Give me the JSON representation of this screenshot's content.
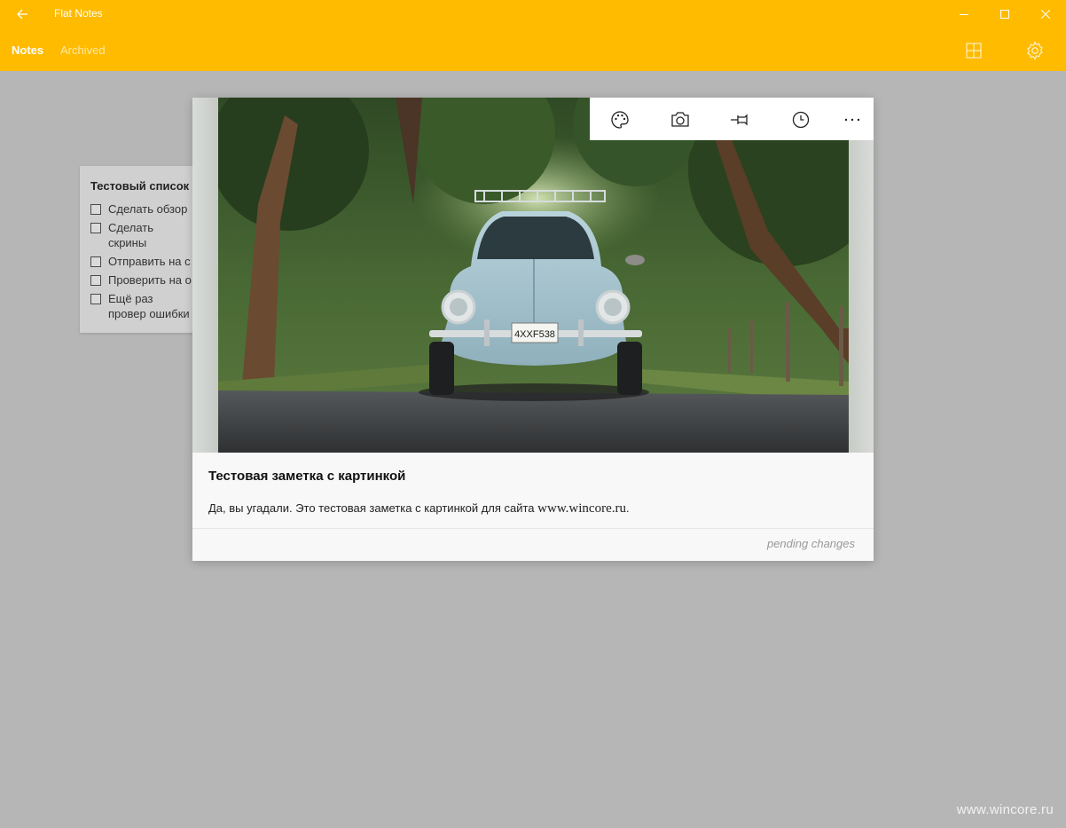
{
  "window": {
    "title": "Flat Notes",
    "back_icon": "arrow-left-icon",
    "minimize_icon": "minimize-icon",
    "maximize_icon": "maximize-icon",
    "close_icon": "close-icon"
  },
  "nav": {
    "tabs": [
      {
        "label": "Notes",
        "active": true
      },
      {
        "label": "Archived",
        "active": false
      }
    ],
    "layout_icon": "grid-layout-icon",
    "settings_icon": "gear-icon"
  },
  "background_note": {
    "title": "Тестовый список",
    "items": [
      {
        "text": "Сделать обзор",
        "checked": false
      },
      {
        "text": "Сделать скрины",
        "checked": false
      },
      {
        "text": "Отправить на с",
        "checked": false
      },
      {
        "text": "Проверить на о",
        "checked": false
      },
      {
        "text": "Ещё раз провер ошибки",
        "checked": false
      }
    ]
  },
  "note": {
    "image": "vintage-car-photo",
    "toolbar": [
      "palette-icon",
      "camera-icon",
      "pin-icon",
      "clock-icon",
      "more-icon"
    ],
    "title": "Тестовая заметка с картинкой",
    "body_prefix": "Да, вы угадали. Это тестовая заметка с картинкой для сайта ",
    "body_site": "www.wincore.ru",
    "body_suffix": ".",
    "status": "pending changes"
  },
  "watermark": "www.wincore.ru",
  "colors": {
    "accent": "#ffbb00",
    "backdrop": "#b6b6b6",
    "card": "#f8f8f8"
  }
}
